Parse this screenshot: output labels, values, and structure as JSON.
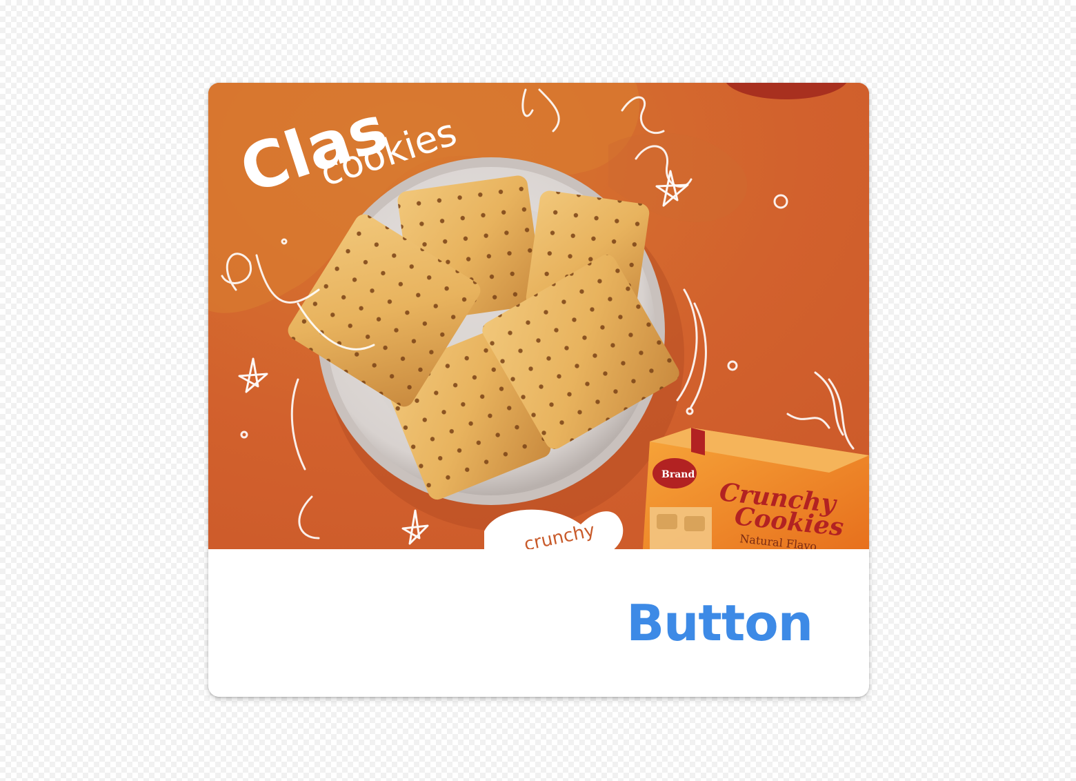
{
  "card": {
    "image": {
      "headline_text": "Clas",
      "subheadline_text": "cookies",
      "bubble_text": "crunchy",
      "box_brand_text": "Brand",
      "box_title_line1": "Crunchy",
      "box_title_line2": "Cookies",
      "box_subtitle": "Natural Flavo"
    },
    "action_button": {
      "label": "Button",
      "color": "#3d8ae6"
    }
  }
}
